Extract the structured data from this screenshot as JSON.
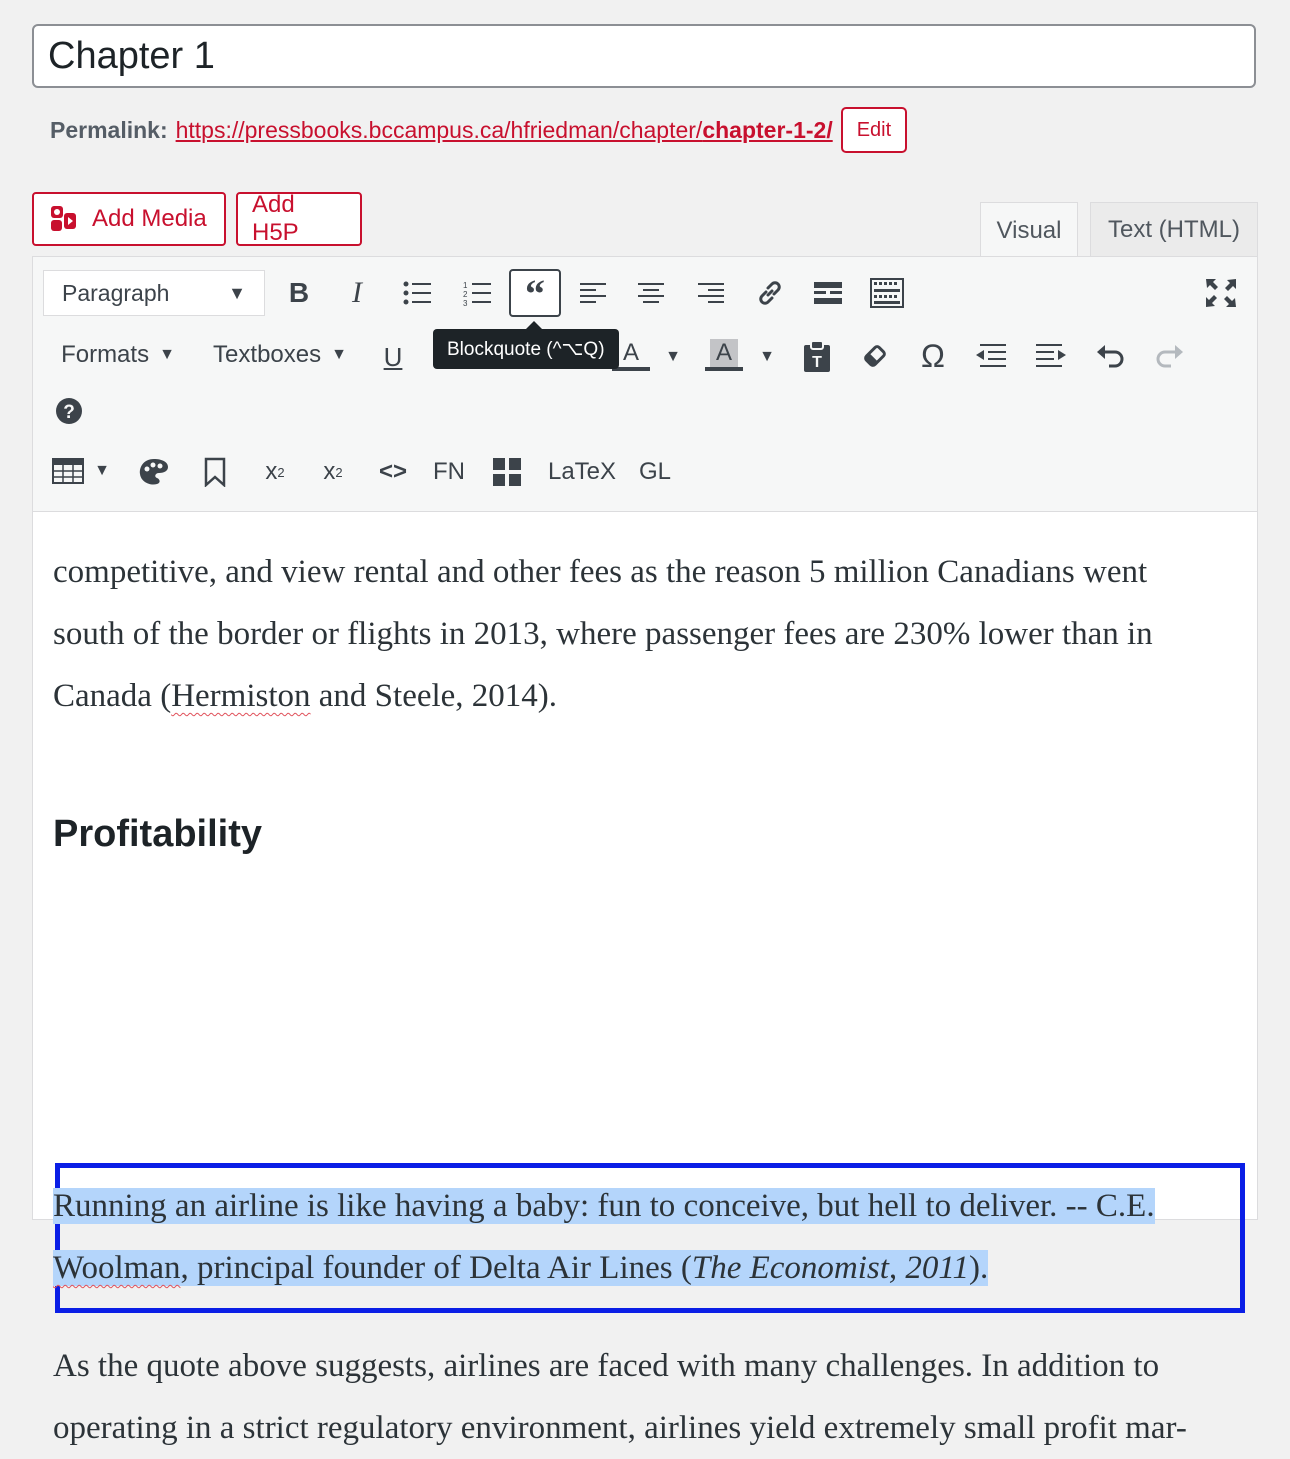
{
  "post": {
    "title": "Chapter 1",
    "permalink_label": "Permalink:",
    "permalink_base": "https://pressbooks.bccampus.ca/hfriedman/chapter/",
    "permalink_slug": "chapter-1-2/",
    "edit_label": "Edit"
  },
  "media_buttons": {
    "add_media": "Add Media",
    "add_h5p": "Add H5P"
  },
  "editor_tabs": {
    "visual": "Visual",
    "text": "Text (HTML)",
    "active": "Visual"
  },
  "toolbar": {
    "format_select": "Paragraph",
    "formats_menu": "Formats",
    "textboxes_menu": "Textboxes",
    "tooltip": "Blockquote (^⌥Q)",
    "fn_label": "FN",
    "latex_label": "LaTeX",
    "gl_label": "GL",
    "text_color_letter": "A",
    "bg_color_letter": "A",
    "icons": [
      "bold-icon",
      "italic-icon",
      "bullet-list-icon",
      "numbered-list-icon",
      "blockquote-icon",
      "align-left-icon",
      "align-center-icon",
      "align-right-icon",
      "link-icon",
      "read-more-icon",
      "toolbar-toggle-icon",
      "fullscreen-icon",
      "underline-icon",
      "strikethrough-icon",
      "horizontal-rule-icon",
      "text-color-icon",
      "background-color-icon",
      "paste-text-icon",
      "clear-formatting-icon",
      "special-character-icon",
      "outdent-icon",
      "indent-icon",
      "undo-icon",
      "redo-icon",
      "help-icon",
      "table-icon",
      "palette-icon",
      "bookmark-icon",
      "superscript-icon",
      "subscript-icon",
      "code-icon",
      "grid-icon"
    ]
  },
  "content": {
    "para1_line1": "competitive, and view rental and other fees as the reason 5 million Canadians went",
    "para1_line2": "south of the border or flights in 2013, where passenger fees are 230% lower than in",
    "para1_line3_pre": "Canada (",
    "para1_line3_misspelled": "Hermiston",
    "para1_line3_post": " and Steele, 2014).",
    "heading": "Profitability",
    "quote_line1": "Running an airline is like having a baby: fun to conceive, but hell to deliver. -- C.E.",
    "quote_line2_misspelled": "Woolman",
    "quote_line2_mid": ", principal founder of Delta Air Lines (",
    "quote_line2_italic": "The Economist, 2011",
    "quote_line2_end": ").",
    "para2_line1": "As the quote above suggests, airlines are faced with many challenges. In addition to",
    "para2_line2": "operating in a strict regulatory environment, airlines yield extremely small profit mar-"
  },
  "colors": {
    "accent": "#c8102e",
    "selection": "#b4d5fb",
    "highlight_border": "#0a1ee6"
  }
}
